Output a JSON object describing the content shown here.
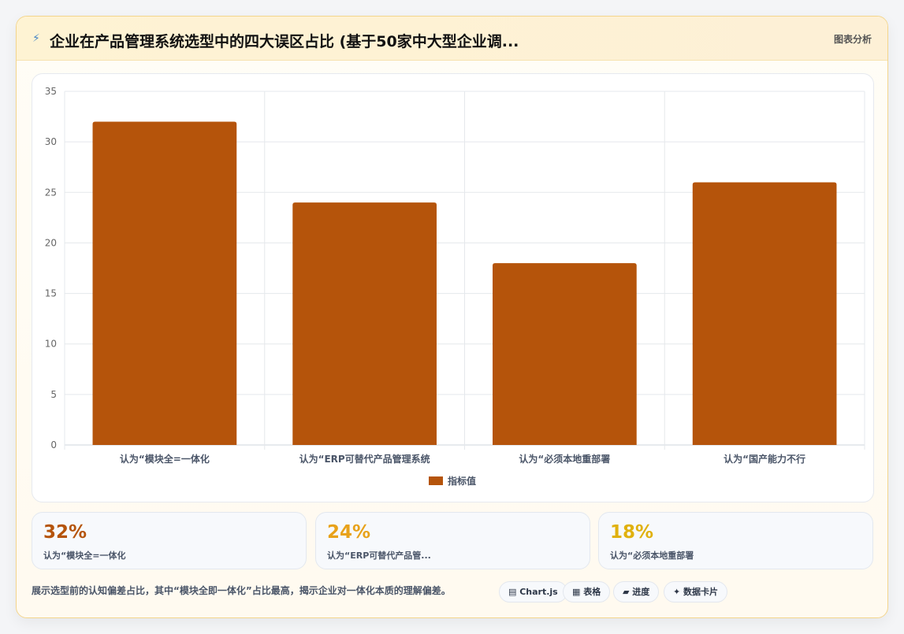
{
  "header": {
    "icon": "lightning-icon",
    "title": "企业在产品管理系统选型中的四大误区占比 (基于50家中大型企业调...",
    "tag": "图表分析"
  },
  "chart_data": {
    "type": "bar",
    "categories": [
      "认为“模块全=一体化",
      "认为“ERP可替代产品管理系统",
      "认为“必须本地重部署",
      "认为“国产能力不行"
    ],
    "series": [
      {
        "name": "指标值",
        "values": [
          32,
          24,
          18,
          26
        ],
        "color": "#b5540b"
      }
    ],
    "ylim": [
      0,
      35
    ],
    "yticks": [
      0,
      5,
      10,
      15,
      20,
      25,
      30,
      35
    ],
    "grid": true,
    "legend": "bottom"
  },
  "stats": [
    {
      "value": "32%",
      "label": "认为“模块全=一体化",
      "color": "#b5540b"
    },
    {
      "value": "24%",
      "label": "认为“ERP可替代产品管...",
      "color": "#e8a21a"
    },
    {
      "value": "18%",
      "label": "认为“必须本地重部署",
      "color": "#e0b10e"
    }
  ],
  "footer": {
    "text": "展示选型前的认知偏差占比，其中“模块全即一体化”占比最高，揭示企业对一体化本质的理解偏差。",
    "pills": [
      {
        "icon": "chart-icon",
        "label": "▤ Chart.js"
      },
      {
        "icon": "table-icon",
        "label": "▦ 表格"
      },
      {
        "icon": "progress-icon",
        "label": "▰ 进度"
      },
      {
        "icon": "sparkle-icon",
        "label": "✦ 数据卡片"
      }
    ]
  }
}
